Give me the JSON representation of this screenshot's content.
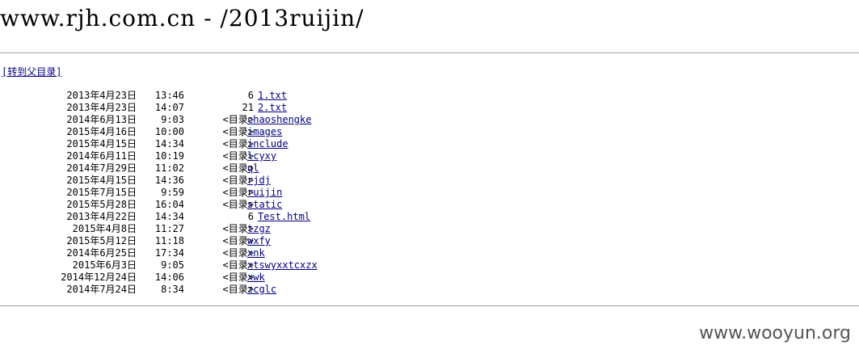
{
  "page": {
    "title": "www.rjh.com.cn - /2013ruijin/",
    "parent_link": "[转到父目录]",
    "dir_marker": "<目录>",
    "link_color": "#000080",
    "rule_color": "#a0a0a0"
  },
  "listing": {
    "rows": [
      {
        "date": "2013年4月23日",
        "time": "13:46",
        "size": "6",
        "name": "1.txt",
        "type": "file"
      },
      {
        "date": "2013年4月23日",
        "time": "14:07",
        "size": "21",
        "name": "2.txt",
        "type": "file"
      },
      {
        "date": "2014年6月13日",
        "time": "9:03",
        "size": "<目录>",
        "name": "chaoshengke",
        "type": "dir"
      },
      {
        "date": "2015年4月16日",
        "time": "10:00",
        "size": "<目录>",
        "name": "images",
        "type": "dir"
      },
      {
        "date": "2015年4月15日",
        "time": "14:34",
        "size": "<目录>",
        "name": "include",
        "type": "dir"
      },
      {
        "date": "2014年6月11日",
        "time": "10:19",
        "size": "<目录>",
        "name": "lcyxy",
        "type": "dir"
      },
      {
        "date": "2014年7月29日",
        "time": "11:02",
        "size": "<目录>",
        "name": "ql",
        "type": "dir"
      },
      {
        "date": "2015年4月15日",
        "time": "14:36",
        "size": "<目录>",
        "name": "rjdj",
        "type": "dir"
      },
      {
        "date": "2015年7月15日",
        "time": "9:59",
        "size": "<目录>",
        "name": "ruijin",
        "type": "dir"
      },
      {
        "date": "2015年5月28日",
        "time": "16:04",
        "size": "<目录>",
        "name": "static",
        "type": "dir"
      },
      {
        "date": "2013年4月22日",
        "time": "14:34",
        "size": "6",
        "name": "Test.html",
        "type": "file"
      },
      {
        "date": "2015年4月8日",
        "time": "11:27",
        "size": "<目录>",
        "name": "tzgz",
        "type": "dir"
      },
      {
        "date": "2015年5月12日",
        "time": "11:18",
        "size": "<目录>",
        "name": "wxfy",
        "type": "dir"
      },
      {
        "date": "2014年6月25日",
        "time": "17:34",
        "size": "<目录>",
        "name": "xnk",
        "type": "dir"
      },
      {
        "date": "2015年6月3日",
        "time": "9:05",
        "size": "<目录>",
        "name": "xtswyxxtcxzx",
        "type": "dir"
      },
      {
        "date": "2014年12月24日",
        "time": "14:06",
        "size": "<目录>",
        "name": "xwk",
        "type": "dir"
      },
      {
        "date": "2014年7月24日",
        "time": "8:34",
        "size": "<目录>",
        "name": "zcglc",
        "type": "dir"
      }
    ]
  },
  "watermark": {
    "text": "www.wooyun.org"
  }
}
